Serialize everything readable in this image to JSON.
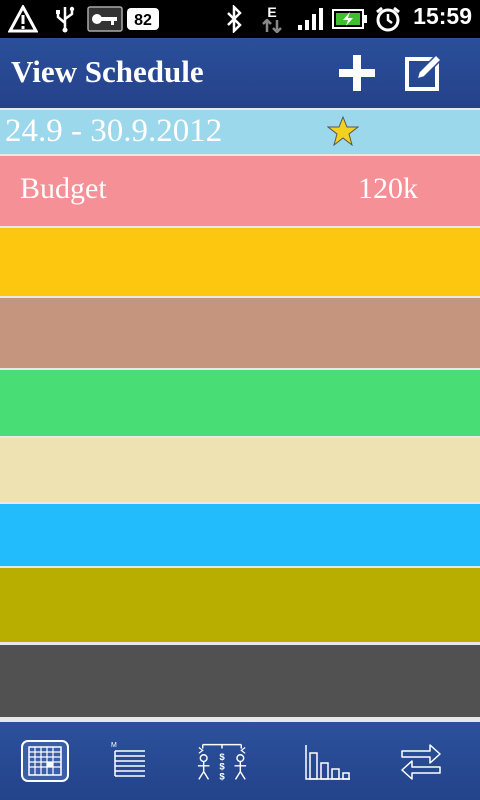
{
  "status_bar": {
    "battery_level": "82",
    "network_type": "E",
    "time": "15:59",
    "icons": [
      "warning-icon",
      "usb-icon",
      "debug-key-icon",
      "battery-level-icon",
      "bluetooth-icon",
      "network-data-icon",
      "signal-icon",
      "battery-charging-icon",
      "alarm-icon"
    ]
  },
  "header": {
    "title": "View Schedule",
    "add_icon": "plus-icon",
    "edit_icon": "edit-icon"
  },
  "schedule": {
    "date_range": "24.9 - 30.9.2012",
    "date_row_color": "#9bd8ec",
    "star_color": "#f2d21e",
    "rows": [
      {
        "label": "Budget",
        "value": "120k",
        "color": "#f49096"
      },
      {
        "label": "",
        "value": "",
        "color": "#fdc70f"
      },
      {
        "label": "",
        "value": "",
        "color": "#c6957d"
      },
      {
        "label": "",
        "value": "",
        "color": "#49dd76"
      },
      {
        "label": "",
        "value": "",
        "color": "#eee2b3"
      },
      {
        "label": "",
        "value": "",
        "color": "#22bbfc"
      },
      {
        "label": "",
        "value": "",
        "color": "#b7ae00"
      },
      {
        "label": "",
        "value": "",
        "color": "#515151"
      }
    ]
  },
  "bottom_nav": {
    "items": [
      "calendar-grid-icon",
      "list-icon",
      "people-budget-icon",
      "bar-chart-icon",
      "swap-arrows-icon"
    ]
  },
  "colors": {
    "header_blue": "#2a4c96",
    "status_black": "#000000"
  }
}
